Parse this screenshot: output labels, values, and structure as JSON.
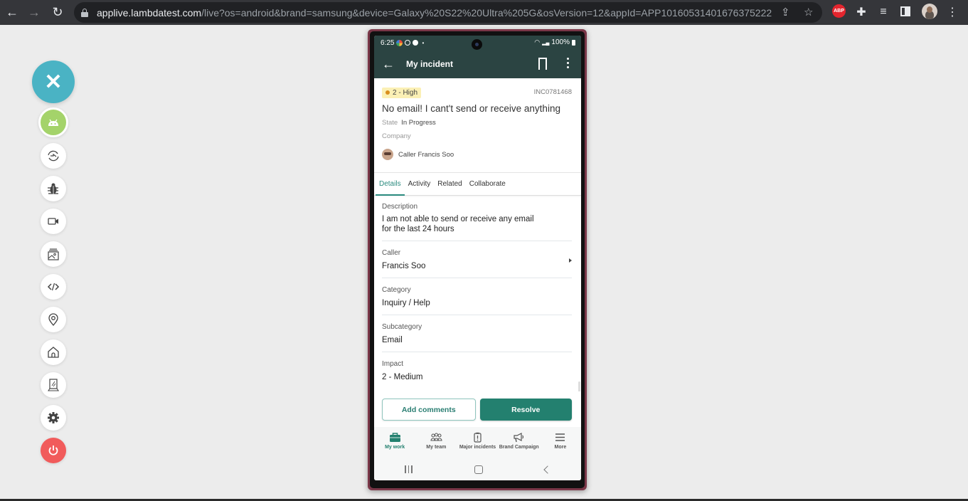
{
  "browser": {
    "url_host": "applive.lambdatest.com",
    "url_path": "/live?os=android&brand=samsung&device=Galaxy%20S22%20Ultra%205G&osVersion=12&appId=APP10160531401676375222...",
    "extensions": [
      "adblock-plus-icon",
      "puzzle-extensions-icon",
      "media-queue-icon",
      "side-panel-icon"
    ],
    "abp_label": "ABP"
  },
  "rail": {
    "tools": [
      "close",
      "android",
      "switch-app",
      "bug",
      "video",
      "gallery",
      "code",
      "location",
      "home",
      "device-frame",
      "settings",
      "power"
    ]
  },
  "device": {
    "status": {
      "time": "6:25",
      "battery": "100%"
    },
    "appbar": {
      "title": "My incident"
    },
    "incident": {
      "priority": "2 - High",
      "number": "INC0781468",
      "title": "No email! I cant't send or receive anything",
      "state_label": "State",
      "state_value": "In Progress",
      "company_label": "Company",
      "caller_label": "Caller Francis Soo"
    },
    "tabs": [
      {
        "label": "Details",
        "active": true
      },
      {
        "label": "Activity",
        "active": false
      },
      {
        "label": "Related",
        "active": false
      },
      {
        "label": "Collaborate",
        "active": false
      }
    ],
    "fields": [
      {
        "label": "Description",
        "value": "I am not able to send or receive any email",
        "value2": "for the last 24 hours"
      },
      {
        "label": "Caller",
        "value": "Francis Soo"
      },
      {
        "label": "Category",
        "value": "Inquiry / Help"
      },
      {
        "label": "Subcategory",
        "value": "Email"
      },
      {
        "label": "Impact",
        "value": "2 - Medium"
      }
    ],
    "actions": {
      "add_comments": "Add comments",
      "resolve": "Resolve"
    },
    "bottom_nav": [
      {
        "label": "My work",
        "icon": "briefcase-icon",
        "active": true
      },
      {
        "label": "My team",
        "icon": "team-icon",
        "active": false
      },
      {
        "label": "Major incidents",
        "icon": "clipboard-alert-icon",
        "active": false
      },
      {
        "label": "Brand Campaign",
        "icon": "megaphone-icon",
        "active": false
      },
      {
        "label": "More",
        "icon": "menu-icon",
        "active": false
      }
    ]
  },
  "colors": {
    "accent": "#23806f",
    "appbar": "#2b4442",
    "rail_close": "#4ab3c4",
    "android": "#a4d36a",
    "power": "#f15b5b",
    "priority_bg": "#fbf0b5"
  }
}
